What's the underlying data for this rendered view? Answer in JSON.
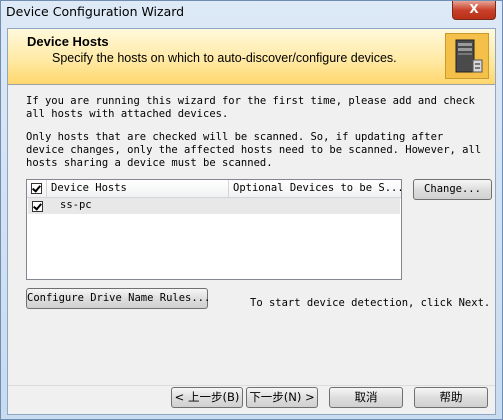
{
  "window": {
    "title": "Device Configuration Wizard",
    "close_glyph": "X"
  },
  "header": {
    "title": "Device Hosts",
    "subtitle": "Specify the hosts on which to auto-discover/configure devices.",
    "icon": "server-icon"
  },
  "body": {
    "intro": "If you are running this wizard for the first time, please add and check all hosts with attached devices.",
    "note": "Only hosts that are checked will be scanned.  So, if updating after device changes, only the affected hosts need to be scanned.  However, all hosts sharing a device must be scanned."
  },
  "hosts_list": {
    "columns": [
      "Device Hosts",
      "Optional Devices to be S..."
    ],
    "header_checked": true,
    "rows": [
      {
        "name": "ss-pc",
        "checked": true,
        "optional": ""
      }
    ]
  },
  "buttons": {
    "change": "Change...",
    "configure_rules": "Configure Drive Name Rules...",
    "back": "< 上一步(B)",
    "next": "下一步(N) >",
    "cancel": "取消",
    "help": "帮助"
  },
  "footer_hint": "To start device detection, click Next."
}
